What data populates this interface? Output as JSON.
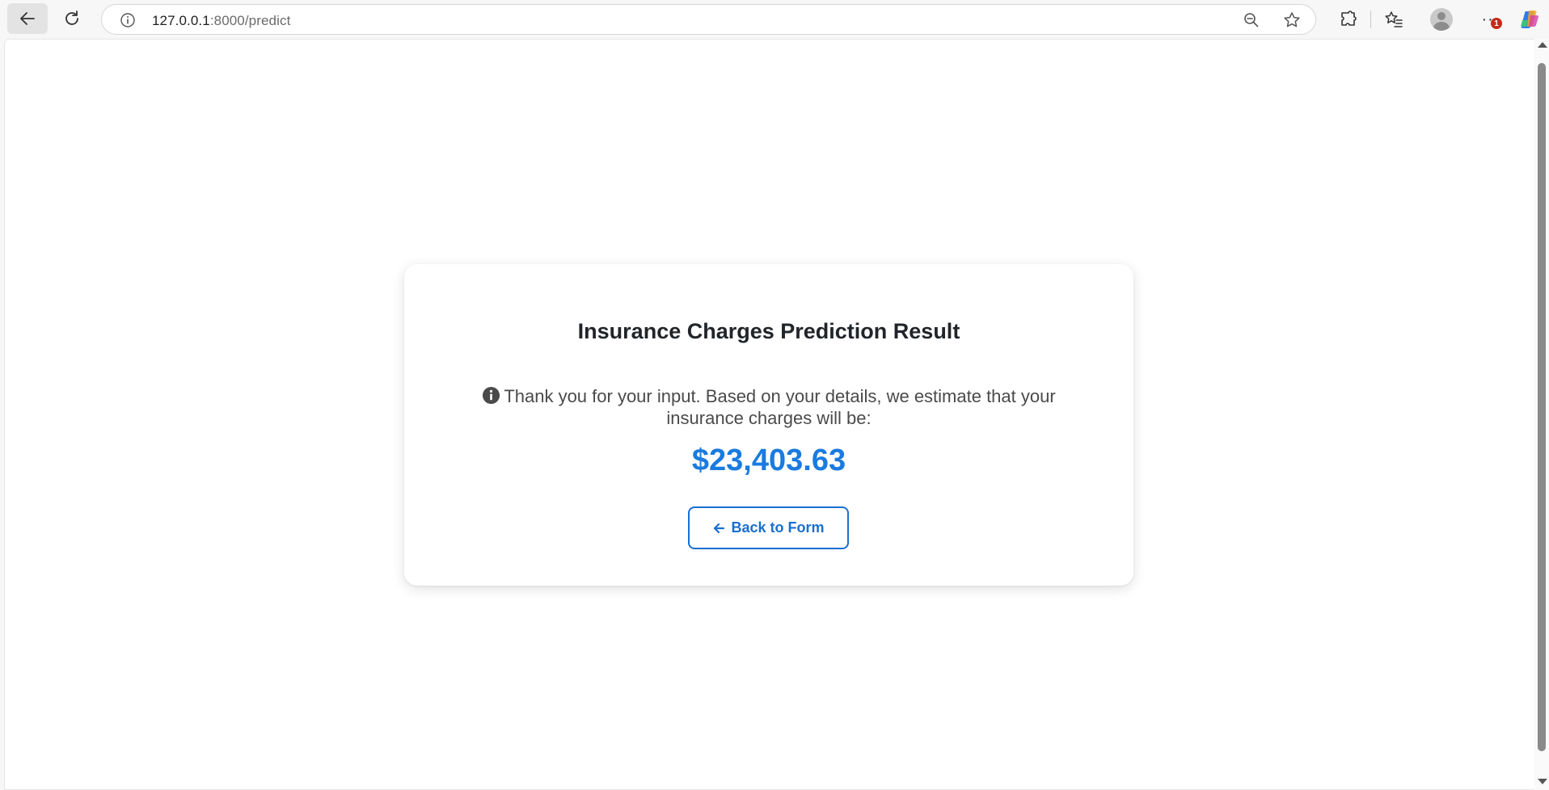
{
  "browser": {
    "url_host": "127.0.0.1",
    "url_rest": ":8000/predict",
    "notification_count": "1",
    "more_label": "···"
  },
  "result": {
    "title": "Insurance Charges Prediction Result",
    "message": "Thank you for your input. Based on your details, we estimate that your insurance charges will be:",
    "amount": "$23,403.63",
    "back_button_label": "Back to Form"
  },
  "colors": {
    "accent": "#1a7be0",
    "button_border": "#1a6fd0",
    "title_text": "#212529",
    "body_text": "#4a4a4a"
  },
  "icons": {
    "back": "arrow-left-icon",
    "reload": "reload-icon",
    "site_info": "info-circle-icon",
    "zoom": "zoom-out-icon",
    "favorite": "star-icon",
    "extensions": "puzzle-icon",
    "favorites_list": "favorites-list-icon",
    "profile": "avatar-icon",
    "copilot": "copilot-icon",
    "message_info": "info-circle-solid-icon",
    "back_to_form": "arrow-left-icon"
  }
}
